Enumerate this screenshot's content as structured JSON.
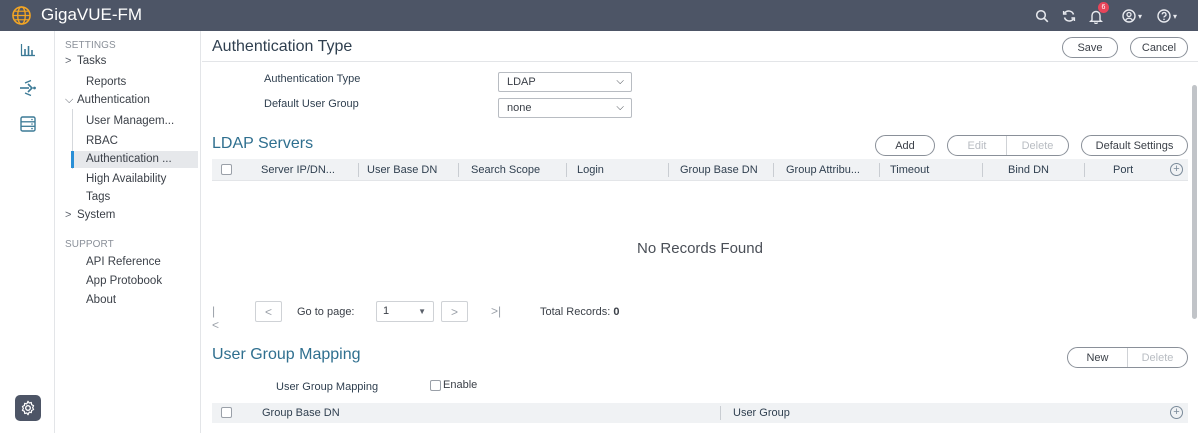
{
  "app": {
    "name": "GigaVUE-FM"
  },
  "topbar": {
    "notification_count": "6"
  },
  "nav": {
    "settings_heading": "SETTINGS",
    "tasks": "Tasks",
    "reports": "Reports",
    "authentication": "Authentication",
    "user_management": "User Managem...",
    "rbac": "RBAC",
    "authentication_type": "Authentication ...",
    "high_availability": "High Availability",
    "tags": "Tags",
    "system": "System",
    "support_heading": "SUPPORT",
    "api_reference": "API Reference",
    "app_protobook": "App Protobook",
    "about": "About"
  },
  "page": {
    "title": "Authentication Type",
    "save_label": "Save",
    "cancel_label": "Cancel"
  },
  "auth_form": {
    "auth_type_label": "Authentication Type",
    "auth_type_value": "LDAP",
    "default_group_label": "Default User Group",
    "default_group_value": "none"
  },
  "ldap": {
    "title": "LDAP Servers",
    "add_label": "Add",
    "edit_label": "Edit",
    "delete_label": "Delete",
    "default_settings_label": "Default Settings",
    "columns": [
      "Server IP/DN...",
      "User Base DN",
      "Search Scope",
      "Login",
      "Group Base DN",
      "Group Attribu...",
      "Timeout",
      "Bind DN",
      "Port"
    ],
    "empty_text": "No Records Found"
  },
  "pager": {
    "first": "|<",
    "prev": "<",
    "goto_label": "Go to page:",
    "page_value": "1",
    "next": ">",
    "last": ">|",
    "total_label": "Total Records:",
    "total_value": "0"
  },
  "ugm": {
    "title": "User Group Mapping",
    "new_label": "New",
    "delete_label": "Delete",
    "label": "User Group Mapping",
    "enable_label": "Enable",
    "columns": [
      "Group Base DN",
      "User Group"
    ]
  }
}
